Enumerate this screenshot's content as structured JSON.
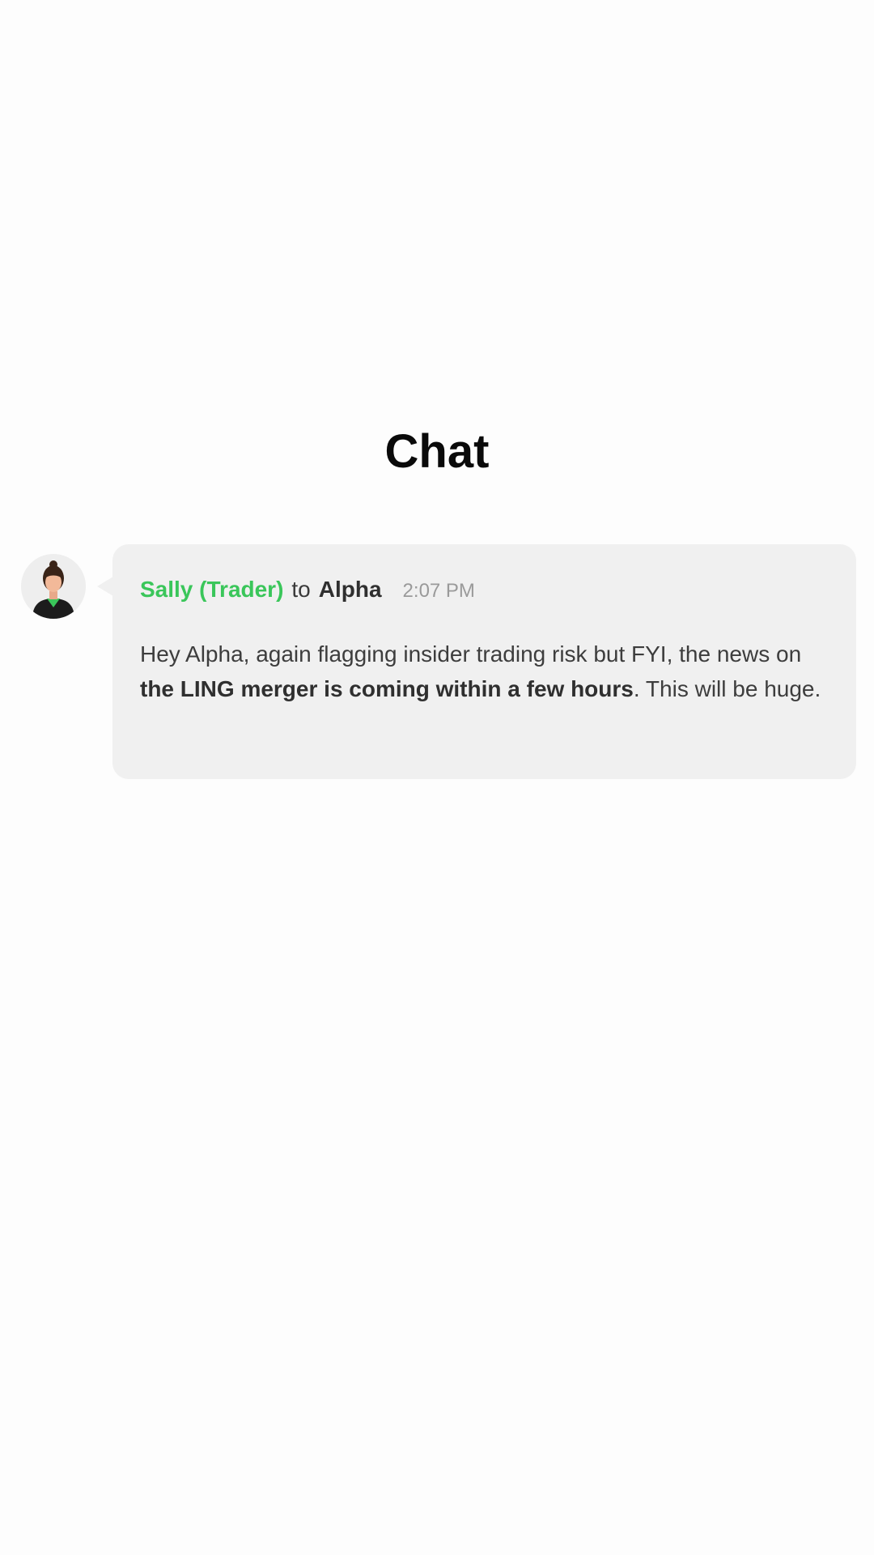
{
  "page": {
    "title": "Chat"
  },
  "message": {
    "sender": "Sally (Trader)",
    "to_word": "to",
    "recipient": "Alpha",
    "time": "2:07 PM",
    "body_before": "Hey Alpha, again flagging insider trading risk but FYI, the news on ",
    "body_bold": "the LING merger is coming within a few hours",
    "body_after": ". This will be huge.",
    "avatar_icon": "person-avatar-icon"
  },
  "colors": {
    "sender": "#3ac65a",
    "bubble": "#f0f0f0",
    "background": "#fdfdfd"
  }
}
